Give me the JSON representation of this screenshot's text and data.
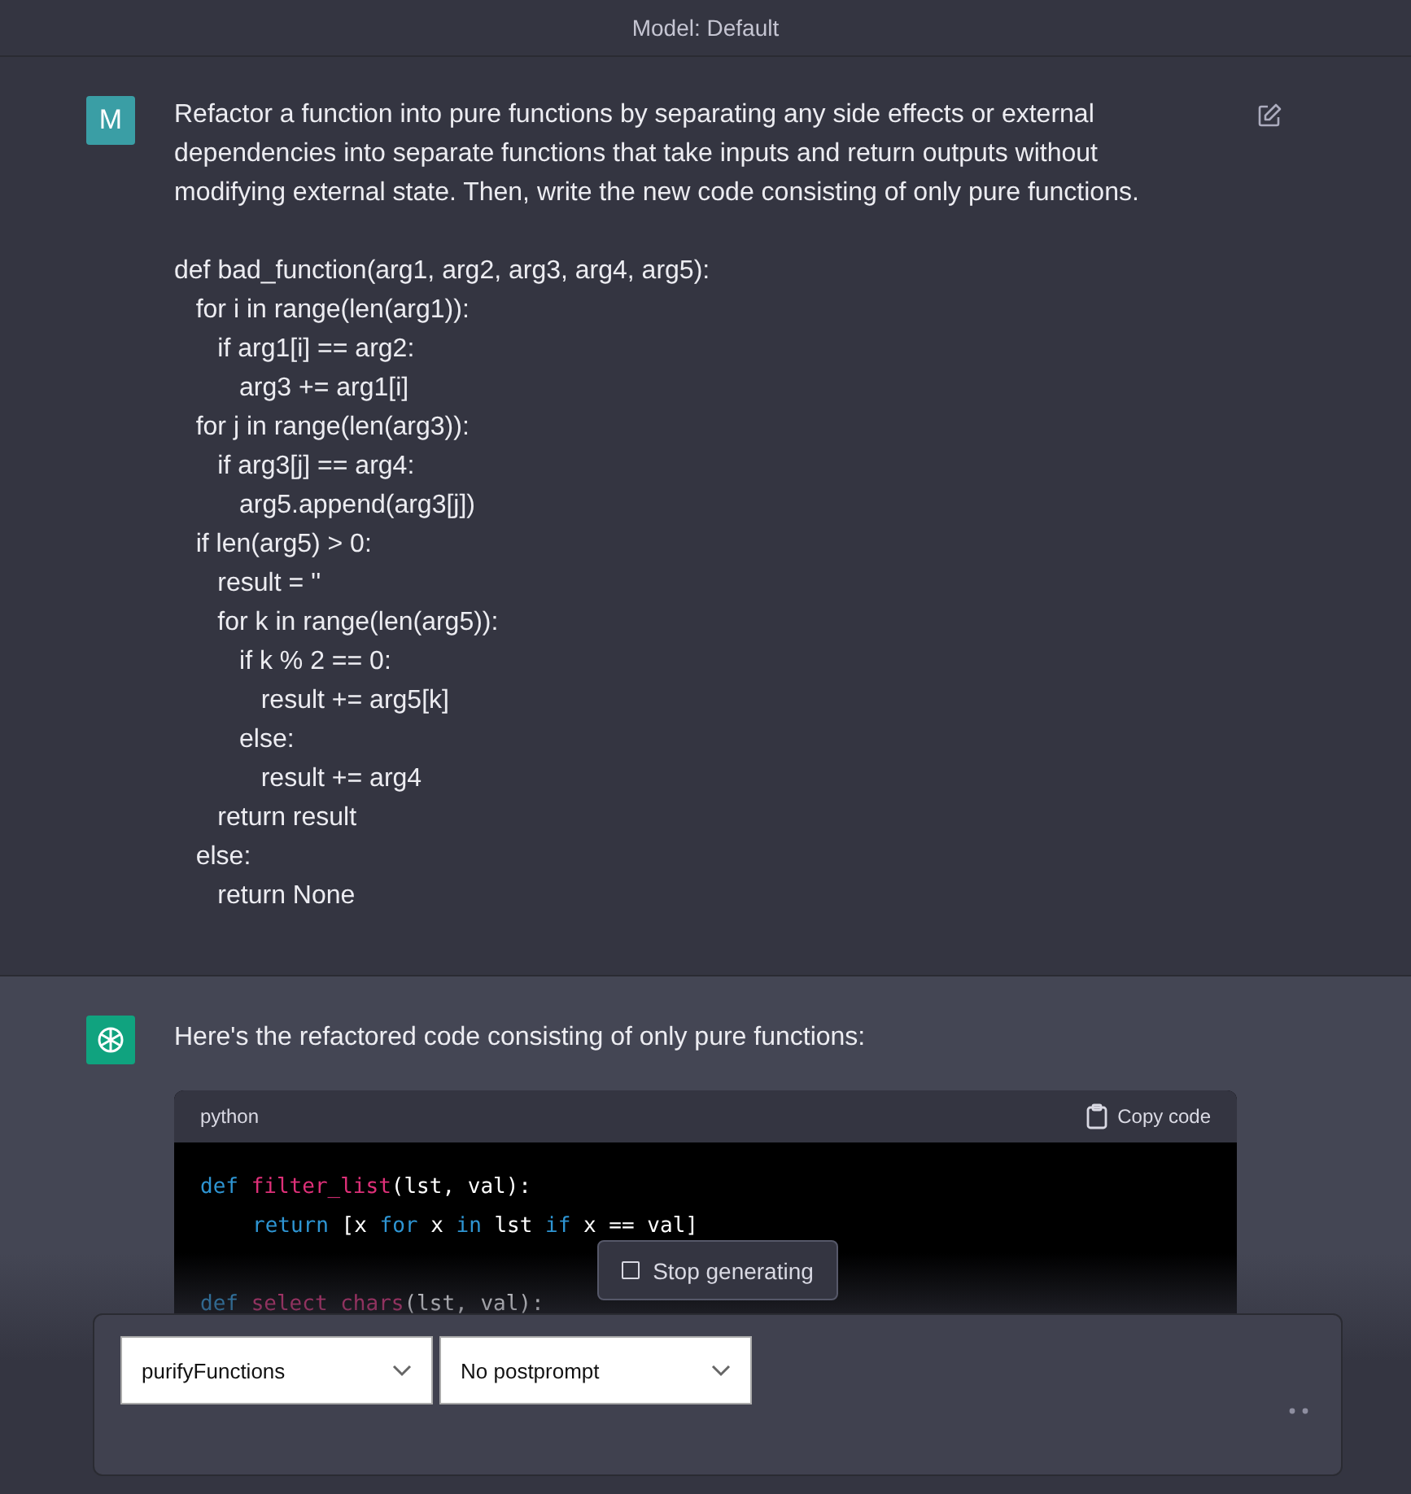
{
  "header": {
    "title": "Model: Default"
  },
  "user_message": {
    "avatar": "M",
    "paragraph": "Refactor a function into pure functions by separating any side effects or external dependencies into separate functions that take inputs and return outputs without modifying external state. Then, write the new code consisting of only pure functions.",
    "code_lines": [
      "def bad_function(arg1, arg2, arg3, arg4, arg5):",
      "   for i in range(len(arg1)):",
      "      if arg1[i] == arg2:",
      "         arg3 += arg1[i]",
      "   for j in range(len(arg3)):",
      "      if arg3[j] == arg4:",
      "         arg5.append(arg3[j])",
      "   if len(arg5) > 0:",
      "      result = ''",
      "      for k in range(len(arg5)):",
      "         if k % 2 == 0:",
      "            result += arg5[k]",
      "         else:",
      "            result += arg4",
      "      return result",
      "   else:",
      "      return None"
    ]
  },
  "assistant_message": {
    "text": "Here's the refactored code consisting of only pure functions:",
    "code_block": {
      "language": "python",
      "copy_label": "Copy code",
      "lines": [
        {
          "indented": false,
          "blank_before": false,
          "tokens": [
            {
              "kind": "keyword",
              "text": "def "
            },
            {
              "kind": "function",
              "text": "filter_list"
            },
            {
              "kind": "plain",
              "text": "(lst, val):"
            }
          ]
        },
        {
          "indented": true,
          "blank_before": false,
          "tokens": [
            {
              "kind": "keyword",
              "text": "return"
            },
            {
              "kind": "plain",
              "text": " [x "
            },
            {
              "kind": "keyword",
              "text": "for"
            },
            {
              "kind": "plain",
              "text": " x "
            },
            {
              "kind": "keyword",
              "text": "in"
            },
            {
              "kind": "plain",
              "text": " lst "
            },
            {
              "kind": "keyword",
              "text": "if"
            },
            {
              "kind": "plain",
              "text": " x == val]"
            }
          ]
        },
        {
          "indented": false,
          "blank_before": true,
          "tokens": [
            {
              "kind": "keyword",
              "text": "def "
            },
            {
              "kind": "function",
              "text": "select_chars"
            },
            {
              "kind": "plain",
              "text": "(lst, val):"
            }
          ]
        }
      ]
    }
  },
  "stop_button": {
    "label": "Stop generating"
  },
  "composer": {
    "selects": [
      {
        "value": "purifyFunctions"
      },
      {
        "value": "No postprompt"
      }
    ]
  }
}
